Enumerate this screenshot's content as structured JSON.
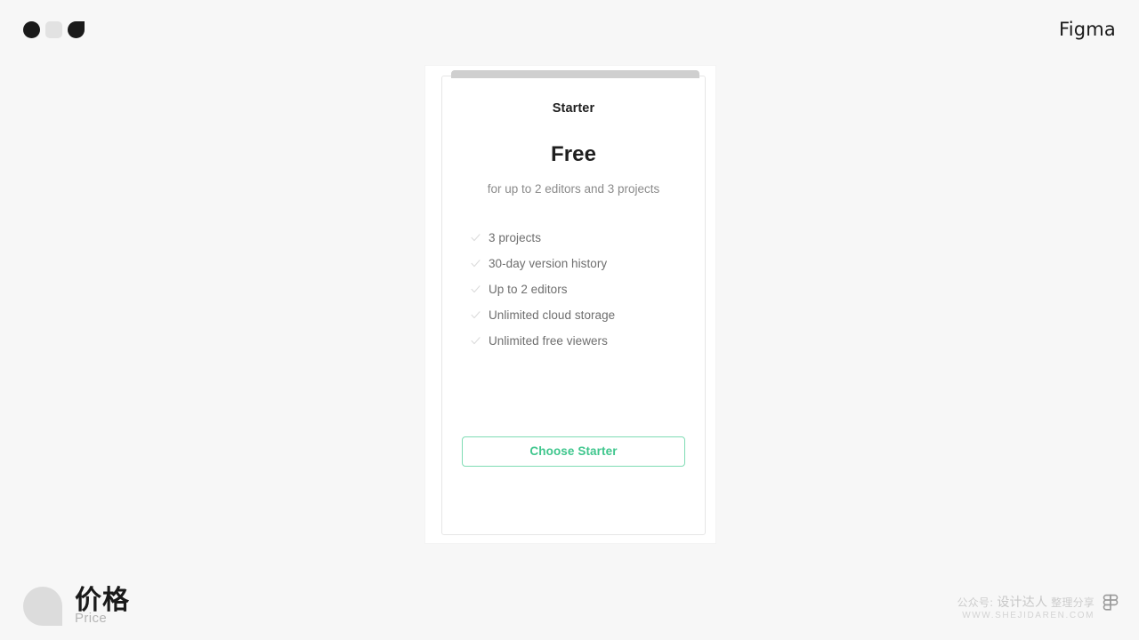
{
  "topbar": {
    "shapes": [
      {
        "icon": "dark-circle-icon"
      },
      {
        "icon": "light-rounded-square-icon"
      },
      {
        "icon": "dark-leaf-icon"
      }
    ],
    "wordmark": "Figma"
  },
  "card": {
    "plan_name": "Starter",
    "price": "Free",
    "subtitle": "for up to 2 editors and 3 projects",
    "features": [
      {
        "check": "check-icon",
        "label": "3 projects"
      },
      {
        "check": "check-icon",
        "label": "30-day version history"
      },
      {
        "check": "check-icon",
        "label": "Up to 2 editors"
      },
      {
        "check": "check-icon",
        "label": "Unlimited cloud storage"
      },
      {
        "check": "check-icon",
        "label": "Unlimited free viewers"
      }
    ],
    "cta_label": "Choose Starter",
    "accent_color": "#3fc68d",
    "accent_border_color": "#7fdcb4",
    "tab_bar_color": "#cfcfcf"
  },
  "caption": {
    "mark": "leaf-mark-icon",
    "title_cn": "价格",
    "title_en": "Price"
  },
  "watermark": {
    "prefix": "公众号: ",
    "brand": "设计达人",
    "suffix": " 整理分享",
    "url": "WWW.SHEJIDAREN.COM",
    "logo": "figma-logo-icon"
  }
}
